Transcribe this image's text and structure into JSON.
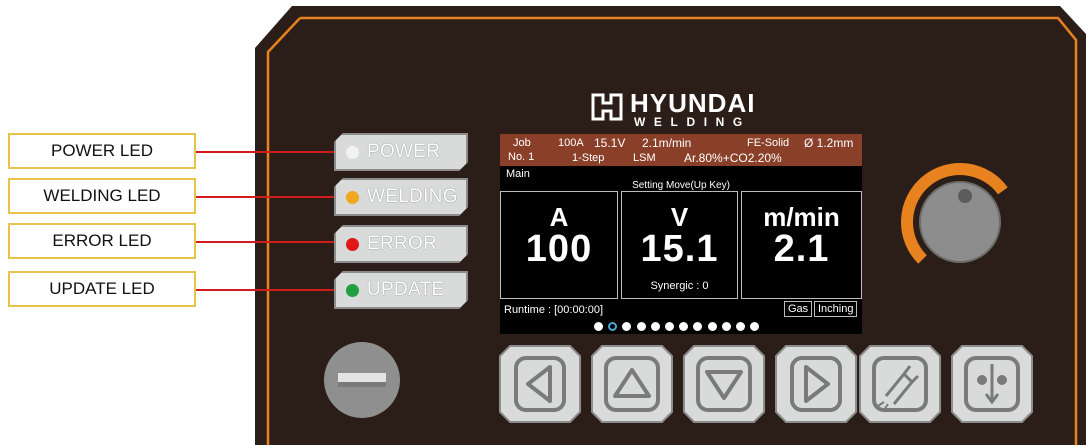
{
  "callouts": [
    {
      "label": "POWER LED"
    },
    {
      "label": "WELDING LED"
    },
    {
      "label": "ERROR LED"
    },
    {
      "label": "UPDATE LED"
    }
  ],
  "leds": [
    {
      "label": "POWER",
      "color": "#f2f2f2"
    },
    {
      "label": "WELDING",
      "color": "#f0a81e"
    },
    {
      "label": "ERROR",
      "color": "#e01818"
    },
    {
      "label": "UPDATE",
      "color": "#22a040"
    }
  ],
  "brand": {
    "name": "HYUNDAI",
    "sub": "WELDING"
  },
  "colors": {
    "panel": "#2b1e18",
    "accent": "#e8821e",
    "screen_header": "#8a3f29",
    "callout_border": "#e8c24a",
    "leader": "#d01c1c"
  },
  "screen": {
    "header": {
      "job_label": "Job",
      "job_no": "No. 1",
      "current": "100A",
      "voltage": "15.1V",
      "wire_speed": "2.1m/min",
      "step": "1-Step",
      "mode": "LSM",
      "gas": "Ar.80%+CO2.20%",
      "wire_type": "FE-Solid",
      "wire_dia": "Ø 1.2mm"
    },
    "mode_label": "Main",
    "hint": "Setting Move(Up Key)",
    "amp": {
      "unit": "A",
      "value": "100"
    },
    "volt": {
      "unit": "V",
      "value": "15.1",
      "synergic": "Synergic : 0"
    },
    "speed": {
      "unit": "m/min",
      "value": "2.1"
    },
    "runtime": "Runtime : [00:00:00]",
    "gas_tag": "Gas",
    "inching_tag": "Inching",
    "page_count": 12,
    "active_page": 2
  },
  "knob": {
    "level": 0.7
  },
  "keys": [
    {
      "name": "left-key",
      "icon": "left-triangle-icon"
    },
    {
      "name": "up-key",
      "icon": "up-triangle-icon"
    },
    {
      "name": "down-key",
      "icon": "down-triangle-icon"
    },
    {
      "name": "right-key",
      "icon": "right-triangle-icon"
    },
    {
      "name": "gas-check-key",
      "icon": "gas-valve-icon"
    },
    {
      "name": "inching-key",
      "icon": "wire-inching-icon"
    }
  ]
}
